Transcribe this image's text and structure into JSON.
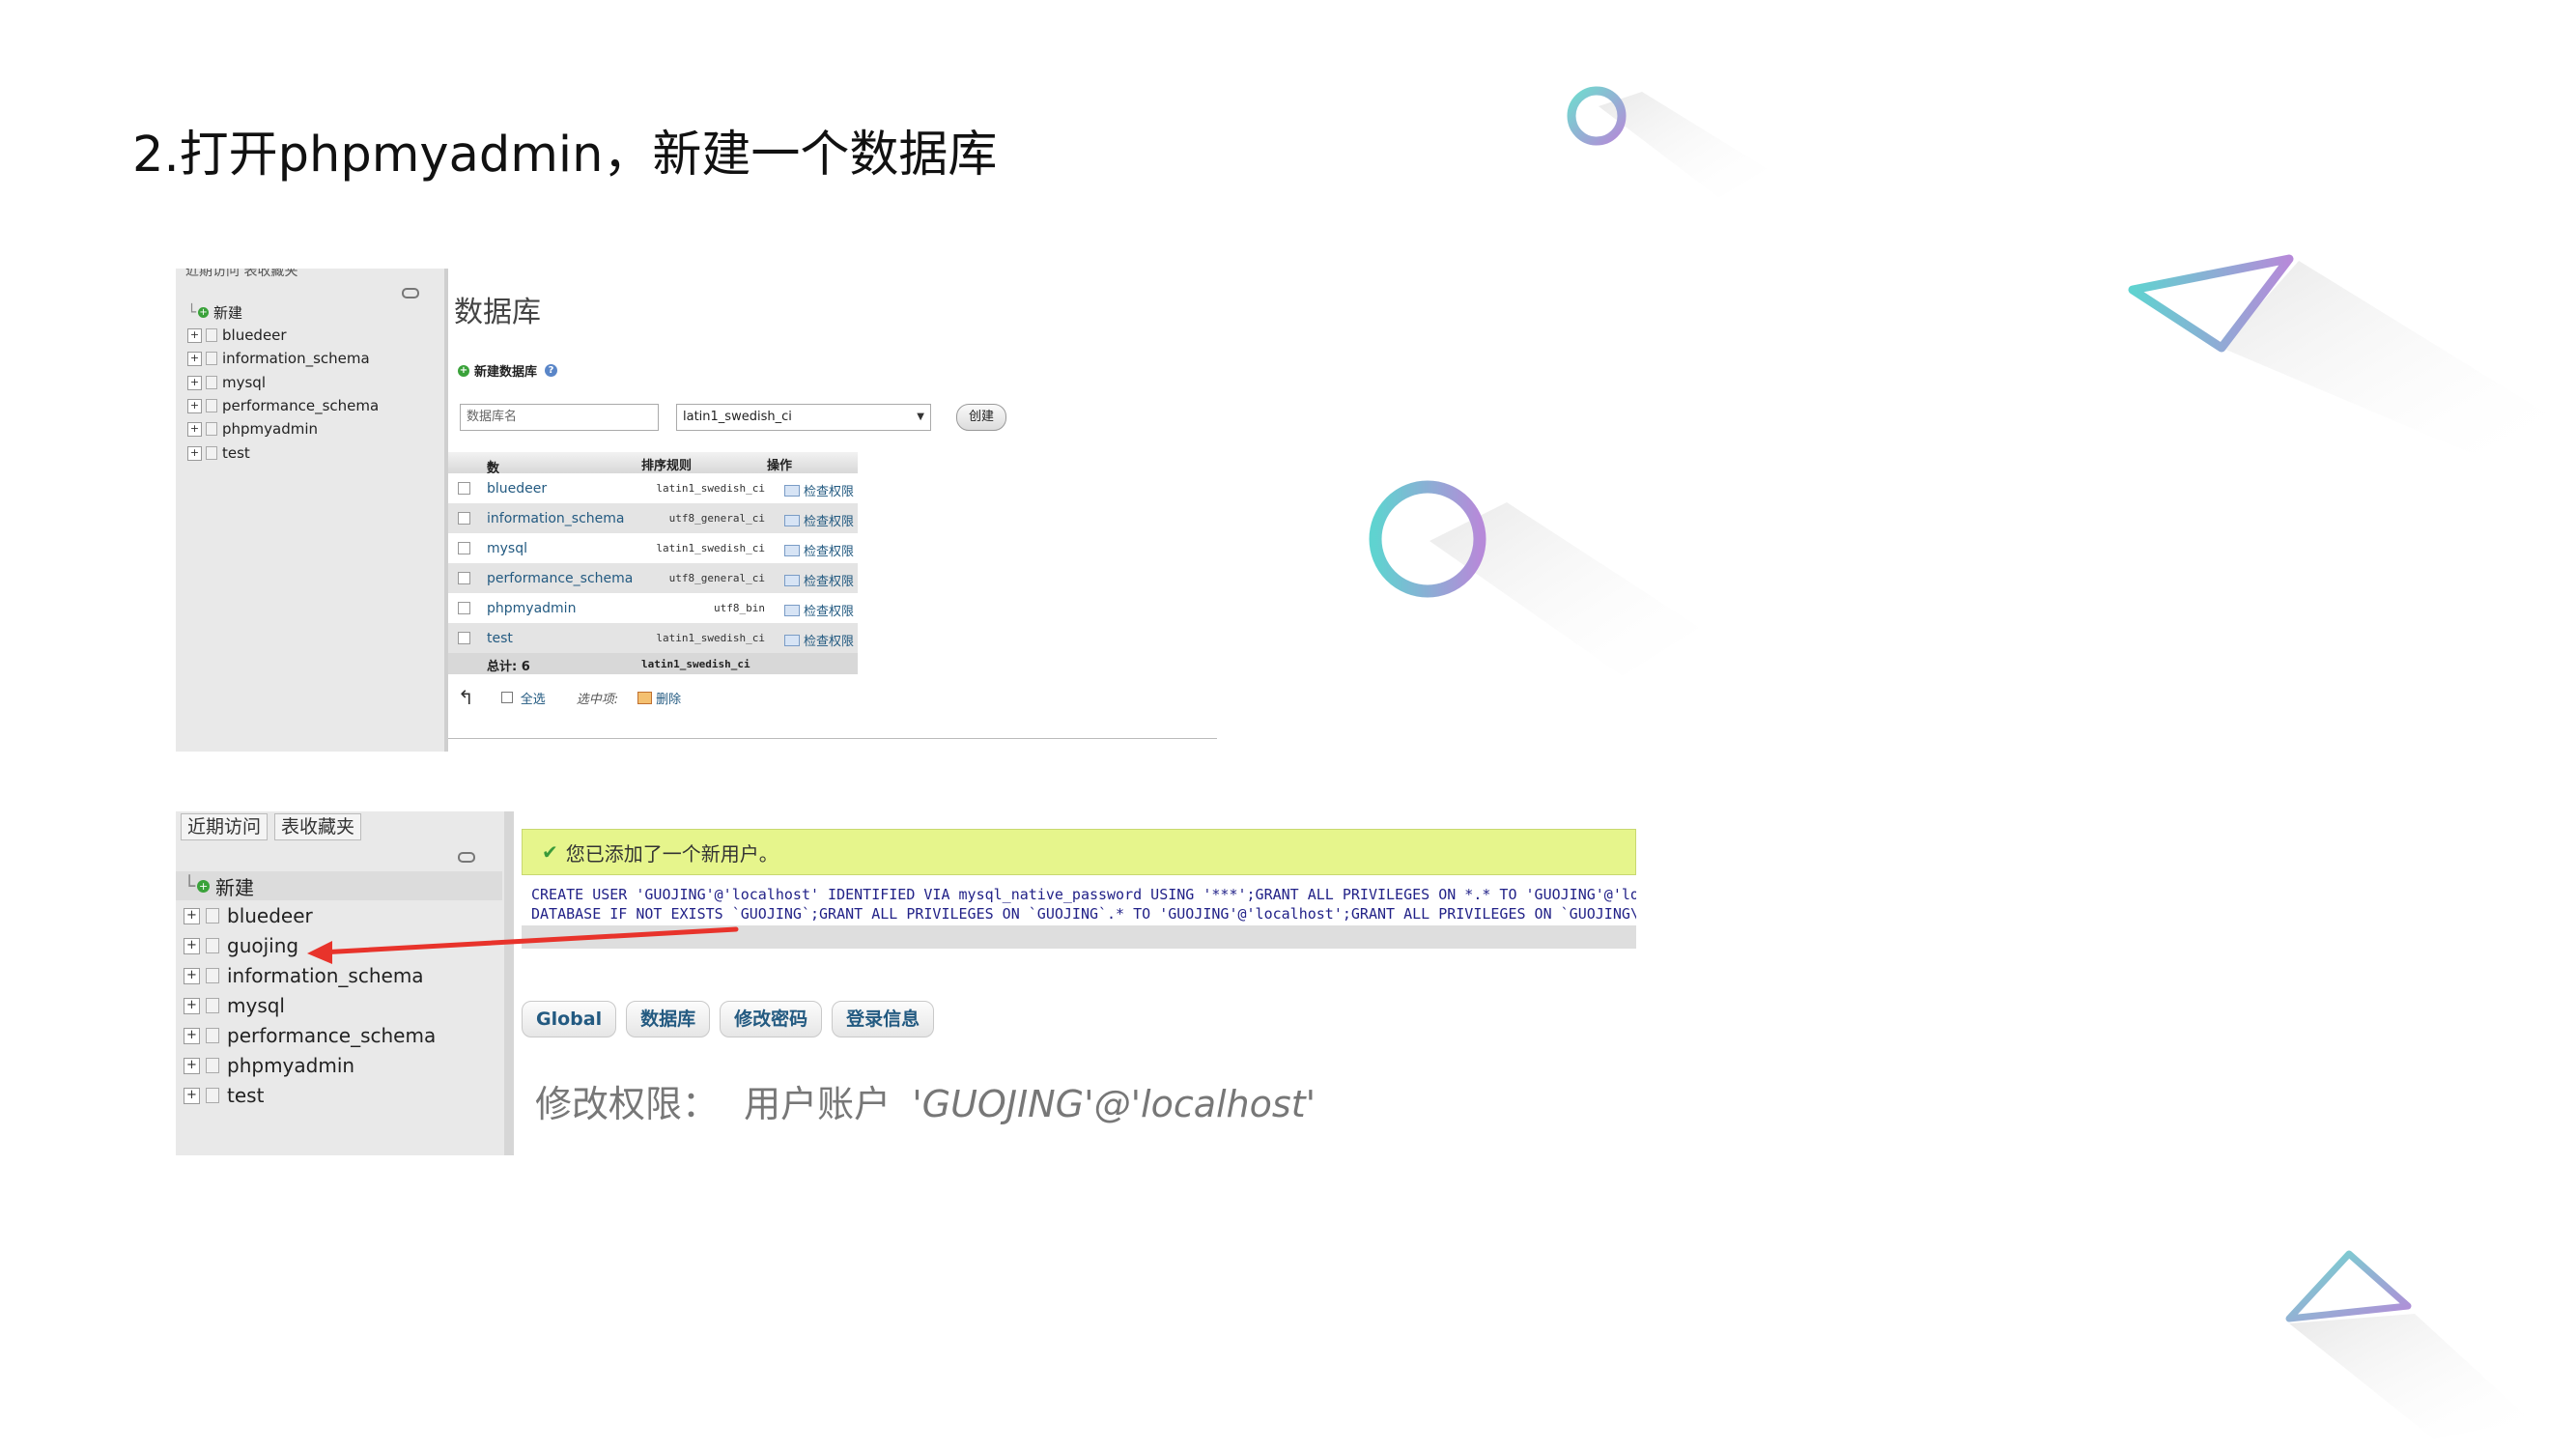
{
  "slide": {
    "title": "2.打开phpmyadmin，新建一个数据库"
  },
  "shot1": {
    "nav": {
      "top_cut_text": "近期访问  表收藏夹",
      "items": [
        {
          "label": "新建",
          "kind": "new"
        },
        {
          "label": "bluedeer",
          "kind": "db"
        },
        {
          "label": "information_schema",
          "kind": "db"
        },
        {
          "label": "mysql",
          "kind": "db"
        },
        {
          "label": "performance_schema",
          "kind": "db"
        },
        {
          "label": "phpmyadmin",
          "kind": "db"
        },
        {
          "label": "test",
          "kind": "db"
        }
      ]
    },
    "main": {
      "heading": "数据库",
      "new_db_label": "新建数据库",
      "db_name_placeholder": "数据库名",
      "collation_selected": "latin1_swedish_ci",
      "create_button": "创建",
      "table": {
        "headers": {
          "db": "数据库",
          "collation": "排序规则",
          "action": "操作"
        },
        "rows": [
          {
            "name": "bluedeer",
            "collation": "latin1_swedish_ci",
            "action": "检查权限"
          },
          {
            "name": "information_schema",
            "collation": "utf8_general_ci",
            "action": "检查权限"
          },
          {
            "name": "mysql",
            "collation": "latin1_swedish_ci",
            "action": "检查权限"
          },
          {
            "name": "performance_schema",
            "collation": "utf8_general_ci",
            "action": "检查权限"
          },
          {
            "name": "phpmyadmin",
            "collation": "utf8_bin",
            "action": "检查权限"
          },
          {
            "name": "test",
            "collation": "latin1_swedish_ci",
            "action": "检查权限"
          }
        ],
        "total_label": "总计: 6",
        "total_collation": "latin1_swedish_ci"
      },
      "bulk": {
        "select_all": "全选",
        "with_selected": "选中项:",
        "delete": "删除"
      }
    }
  },
  "shot2": {
    "nav": {
      "tab_recent": "近期访问",
      "tab_favorites": "表收藏夹",
      "items": [
        {
          "label": "新建",
          "kind": "new"
        },
        {
          "label": "bluedeer",
          "kind": "db"
        },
        {
          "label": "guojing",
          "kind": "db"
        },
        {
          "label": "information_schema",
          "kind": "db"
        },
        {
          "label": "mysql",
          "kind": "db"
        },
        {
          "label": "performance_schema",
          "kind": "db"
        },
        {
          "label": "phpmyadmin",
          "kind": "db"
        },
        {
          "label": "test",
          "kind": "db"
        }
      ]
    },
    "main": {
      "success_message": "您已添加了一个新用户。",
      "sql_line1": "CREATE USER 'GUOJING'@'localhost' IDENTIFIED VIA mysql_native_password USING '***';GRANT ALL PRIVILEGES ON *.* TO 'GUOJING'@'loc",
      "sql_line2": "DATABASE IF NOT EXISTS `GUOJING`;GRANT ALL PRIVILEGES ON `GUOJING`.* TO 'GUOJING'@'localhost';GRANT ALL PRIVILEGES ON `GUOJING\\_",
      "tabs": [
        "Global",
        "数据库",
        "修改密码",
        "登录信息"
      ],
      "edit_label": "修改权限：",
      "user_account_label": "用户账户",
      "user_account_value": "'GUOJING'@'localhost'"
    }
  },
  "colors": {
    "link": "#235a81",
    "success_bg": "#e6f58c",
    "arrow": "#e8332b",
    "deco_teal": "#5fd3d0",
    "deco_purple": "#b68ad9"
  }
}
